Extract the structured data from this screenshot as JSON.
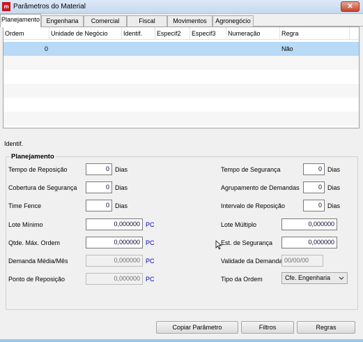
{
  "window": {
    "title": "Parâmetros do Material",
    "close_glyph": "✕"
  },
  "tabs": [
    "Planejamento",
    "Engenharia",
    "Comercial",
    "Fiscal",
    "Movimentos",
    "Agronegócio"
  ],
  "grid": {
    "columns": [
      "Ordem",
      "Unidade de Negócio",
      "Identif.",
      "Especif2",
      "Especif3",
      "Numeração",
      "Regra"
    ],
    "rows": [
      {
        "ordem": "0",
        "regra": "Não"
      }
    ]
  },
  "identif_label": "Identif.",
  "planejamento": {
    "title": "Planejamento",
    "tempo_reposicao": {
      "label": "Tempo de Reposição",
      "value": "0",
      "unit": "Dias"
    },
    "cobertura_seguranca": {
      "label": "Cobertura de Segurança",
      "value": "0",
      "unit": "Dias"
    },
    "time_fence": {
      "label": "Time Fence",
      "value": "0",
      "unit": "Dias"
    },
    "lote_minimo": {
      "label": "Lote Mínimo",
      "value": "0,000000",
      "unit": "PC"
    },
    "qtde_max_ordem": {
      "label": "Qtde. Máx. Ordem",
      "value": "0,000000",
      "unit": "PC"
    },
    "demanda_media": {
      "label": "Demanda Média/Mês",
      "value": "0,000000",
      "unit": "PC"
    },
    "ponto_reposicao": {
      "label": "Ponto de Reposição",
      "value": "0,000000",
      "unit": "PC"
    },
    "tempo_seguranca": {
      "label": "Tempo de Segurança",
      "value": "0",
      "unit": "Dias"
    },
    "agrupamento_demandas": {
      "label": "Agrupamento de Demandas",
      "value": "0",
      "unit": "Dias"
    },
    "intervalo_reposicao": {
      "label": "Intervalo de Reposição",
      "value": "0",
      "unit": "Dias"
    },
    "lote_multiplo": {
      "label": "Lote Múltiplo",
      "value": "0,000000"
    },
    "est_seguranca": {
      "label": "Est. de Segurança",
      "value": "0,000000"
    },
    "validade_demanda": {
      "label": "Validade da Demanda",
      "placeholder": "00/00/00"
    },
    "tipo_ordem": {
      "label": "Tipo da Ordem",
      "value": "Cfe. Engenharia"
    }
  },
  "buttons": {
    "copiar": "Copiar Parâmetro",
    "filtros": "Filtros",
    "regras": "Regras"
  },
  "colors": {
    "selected_row": "#b8daf6",
    "unit_blue": "#0000c0"
  }
}
